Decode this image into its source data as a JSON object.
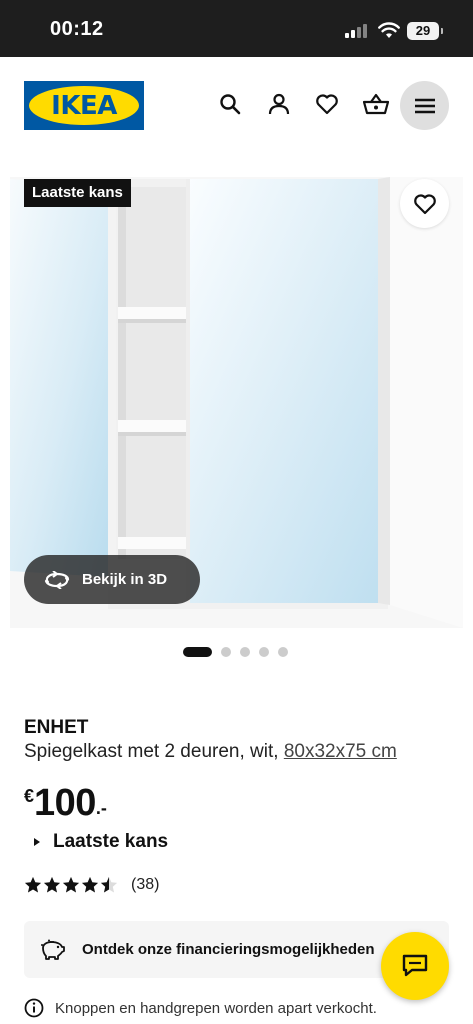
{
  "status_bar": {
    "time": "00:12",
    "battery": "29",
    "icons": [
      "signal-icon",
      "wifi-icon",
      "battery-icon"
    ]
  },
  "header": {
    "logo_text": "IKEA",
    "icons": [
      "search-icon",
      "account-icon",
      "heart-icon",
      "basket-icon",
      "menu-icon"
    ]
  },
  "colors": {
    "ikea_blue": "#0058a3",
    "ikea_yellow": "#ffdb00",
    "text": "#111111",
    "badge_bg": "#111111"
  },
  "gallery": {
    "badge": "Laatste kans",
    "view3d_label": "Bekijk in 3D",
    "slide_count": 5,
    "active_slide": 1
  },
  "product": {
    "name": "ENHET",
    "description": "Spiegelkast met 2 deuren, wit,",
    "measurement": "80x32x75 cm",
    "price_currency": "€",
    "price_integer": "100",
    "price_decimal": ".-",
    "availability": "Laatste kans",
    "rating": 4.5,
    "rating_max": 5,
    "review_count": "(38)"
  },
  "finance": {
    "label": "Ontdek onze financieringsmogelijkheden",
    "icon": "piggy-bank-icon"
  },
  "chat": {
    "icon": "chat-icon"
  },
  "note": {
    "icon": "info-icon",
    "text": "Knoppen en handgrepen worden apart verkocht."
  }
}
